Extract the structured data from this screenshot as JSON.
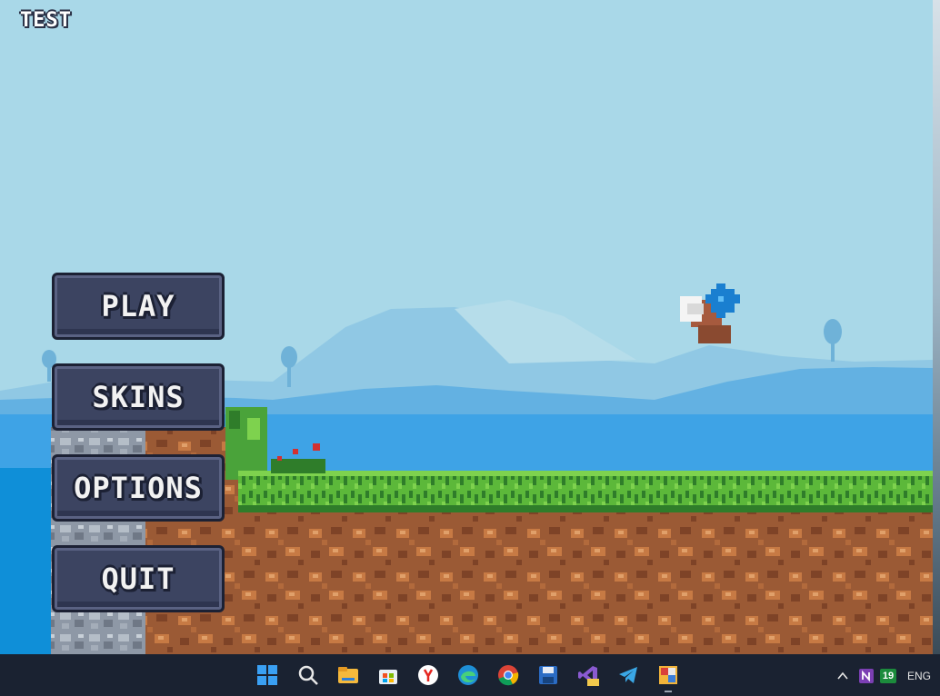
{
  "game": {
    "title": "TEST",
    "menu": {
      "play_label": "PLAY",
      "skins_label": "SKINS",
      "options_label": "OPTIONS",
      "quit_label": "QUIT"
    },
    "colors": {
      "sky": "#a9d8e8",
      "button_fill": "#3c4461",
      "button_border": "#1c2134",
      "grass": "#5cb83a",
      "dirt": "#9b5a35",
      "water": "#0f8fd8"
    }
  },
  "taskbar": {
    "icons": [
      "start-icon",
      "search-icon",
      "file-explorer-icon",
      "store-icon",
      "yandex-browser-icon",
      "edge-icon",
      "chrome-icon",
      "save-icon",
      "visual-studio-icon",
      "telegram-icon",
      "game-app-icon"
    ],
    "tray": {
      "badge": "19",
      "language": "ENG"
    }
  }
}
